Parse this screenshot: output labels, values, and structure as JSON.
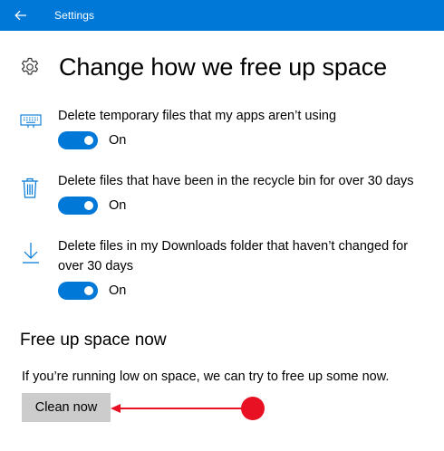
{
  "titlebar": {
    "app_title": "Settings",
    "back_icon": "back-arrow-icon",
    "bg_color": "#0078d7"
  },
  "page": {
    "title": "Change how we free up space",
    "icon": "gear-icon"
  },
  "settings": [
    {
      "label": "Delete temporary files that my apps aren’t using",
      "icon": "keyboard-icon",
      "toggle_state": "On",
      "toggle_on": true
    },
    {
      "label": "Delete files that have been in the recycle bin for over 30 days",
      "icon": "recycle-bin-icon",
      "toggle_state": "On",
      "toggle_on": true
    },
    {
      "label": "Delete files in my Downloads folder that haven’t changed for over 30 days",
      "icon": "download-icon",
      "toggle_state": "On",
      "toggle_on": true
    }
  ],
  "free_up_now": {
    "heading": "Free up space now",
    "description": "If you’re running low on space, we can try to free up some now.",
    "button_label": "Clean now"
  },
  "annotation": {
    "color": "#e81123",
    "icon": "red-arrow-annotation"
  },
  "accent_color": "#0078d7"
}
